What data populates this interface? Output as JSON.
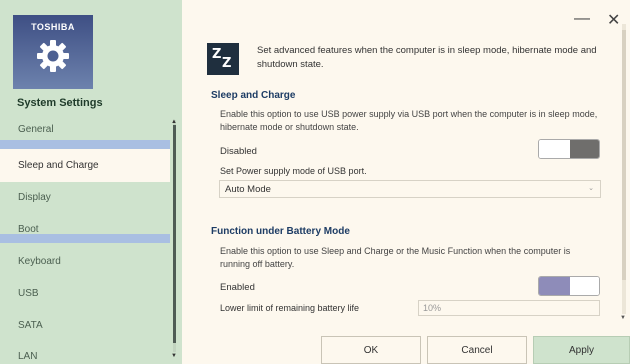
{
  "window": {
    "minimize_symbol": "—",
    "close_symbol": "✕"
  },
  "sidebar": {
    "logo_text": "TOSHIBA",
    "title": "System Settings",
    "items": [
      {
        "label": "General"
      },
      {
        "label": "Sleep and Charge"
      },
      {
        "label": "Display"
      },
      {
        "label": "Boot"
      },
      {
        "label": "Keyboard"
      },
      {
        "label": "USB"
      },
      {
        "label": "SATA"
      },
      {
        "label": "LAN"
      }
    ],
    "selected": "Sleep and Charge"
  },
  "content": {
    "icon_name": "sleep-zz-icon",
    "icon_glyphs": {
      "z1": "Z",
      "z2": "Z"
    },
    "intro": "Set advanced features when the computer is in sleep mode, hibernate mode and shutdown state.",
    "sleep_charge": {
      "heading": "Sleep and Charge",
      "description": "Enable this option to use USB power supply via USB port when the computer is in sleep mode, hibernate mode or shutdown state.",
      "state_label": "Disabled",
      "toggle_on": false,
      "supply_mode_label": "Set Power supply mode of USB port.",
      "supply_mode_value": "Auto Mode"
    },
    "battery_mode": {
      "heading": "Function under Battery Mode",
      "description": "Enable this option to use Sleep and Charge or the Music Function when the computer is running off battery.",
      "state_label": "Enabled",
      "toggle_on": true,
      "lower_limit_label": "Lower limit of remaining battery life",
      "lower_limit_value": "10%"
    }
  },
  "buttons": {
    "ok": "OK",
    "cancel": "Cancel",
    "apply": "Apply"
  },
  "colors": {
    "sidebar_bg": "#cfe3cd",
    "content_bg": "#fdf8ee",
    "logo_tile": "#4a5c8f",
    "toggle_dark": "#6f6e6c",
    "toggle_on": "#8e8cb9",
    "heading": "#1d3c64"
  }
}
